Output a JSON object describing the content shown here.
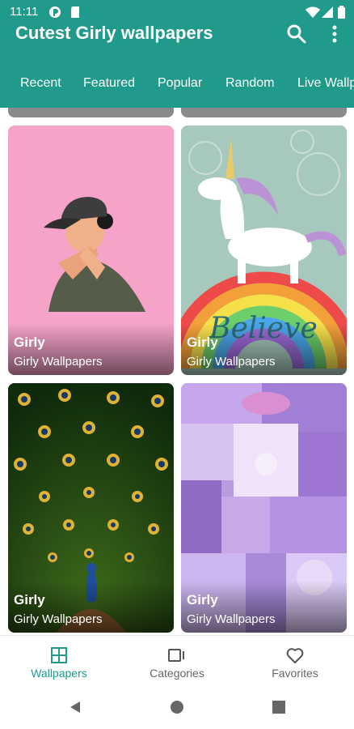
{
  "status_bar": {
    "time": "11:11"
  },
  "app_bar": {
    "title": "Cutest Girly wallpapers"
  },
  "tabs": [
    {
      "label": "Recent"
    },
    {
      "label": "Featured"
    },
    {
      "label": "Popular"
    },
    {
      "label": "Random"
    },
    {
      "label": "Live Wallpapers"
    }
  ],
  "cards": [
    {
      "title": "Girly",
      "subtitle": "Girly Wallpapers"
    },
    {
      "title": "Girly",
      "subtitle": "Girly Wallpapers"
    },
    {
      "title": "Girly",
      "subtitle": "Girly Wallpapers"
    },
    {
      "title": "Girly",
      "subtitle": "Girly Wallpapers"
    }
  ],
  "card_images": [
    "girl-cap-illustration",
    "unicorn-rainbow-believe",
    "peacock-feathers",
    "purple-aesthetic-collage"
  ],
  "bottom_nav": [
    {
      "label": "Wallpapers",
      "icon": "grid-icon",
      "active": true
    },
    {
      "label": "Categories",
      "icon": "categories-icon",
      "active": false
    },
    {
      "label": "Favorites",
      "icon": "heart-icon",
      "active": false
    }
  ],
  "colors": {
    "primary": "#1f9a8b",
    "active_nav": "#1f9a8b",
    "inactive_nav": "#666666"
  }
}
